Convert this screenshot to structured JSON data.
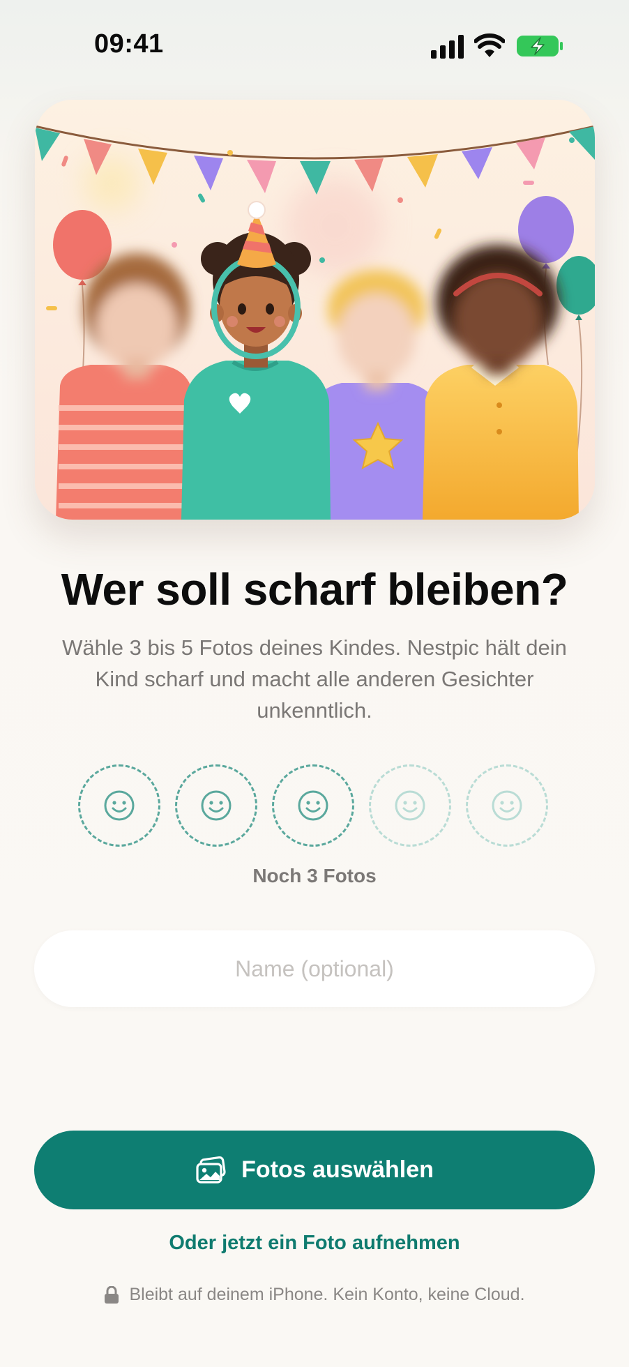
{
  "status_bar": {
    "time": "09:41",
    "icons": [
      "cellular-signal-icon",
      "wifi-icon",
      "battery-charging-icon"
    ],
    "battery_color": "#34c759"
  },
  "hero": {
    "illustration": "party-illustration",
    "description_icons": [
      "bunting-flags",
      "balloons",
      "confetti",
      "party-hat",
      "face-highlight-ring"
    ]
  },
  "title": "Wer soll scharf bleiben?",
  "subtitle": "Wähle 3 bis 5 Fotos deines Kindes. Nestpic hält dein Kind scharf und macht alle anderen Gesichter unkenntlich.",
  "photo_slots": [
    {
      "icon": "smiley-icon",
      "state": "required"
    },
    {
      "icon": "smiley-icon",
      "state": "required"
    },
    {
      "icon": "smiley-icon",
      "state": "required"
    },
    {
      "icon": "smiley-icon",
      "state": "optional"
    },
    {
      "icon": "smiley-icon",
      "state": "optional"
    }
  ],
  "remaining_text": "Noch 3 Fotos",
  "name_input": {
    "placeholder": "Name (optional)",
    "value": ""
  },
  "primary_button": {
    "label": "Fotos auswählen",
    "icon": "photos-icon"
  },
  "secondary_link": "Oder jetzt ein Foto aufnehmen",
  "privacy_note": {
    "icon": "lock-icon",
    "text": "Bleibt auf deinem iPhone. Kein Konto, keine Cloud."
  },
  "colors": {
    "accent": "#0e7e72",
    "accent_text": "#0f7b6f",
    "slot_border": "#5aa89d",
    "slot_border_dim": "#b9dcd5",
    "background": "#faf8f4"
  }
}
